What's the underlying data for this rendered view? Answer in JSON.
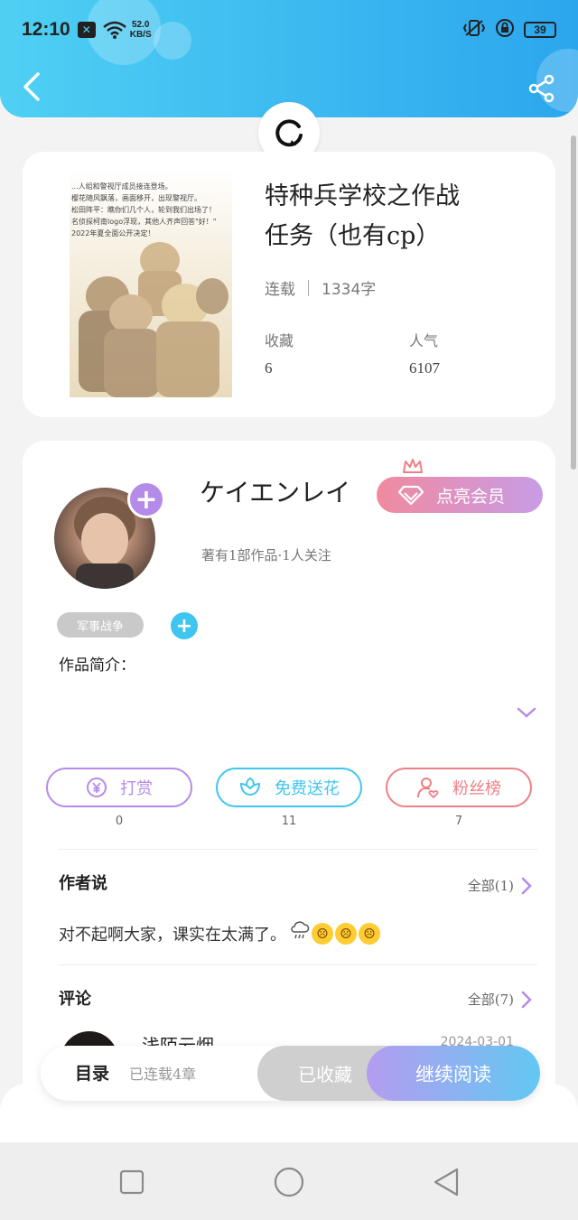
{
  "status_bar": {
    "time": "12:10",
    "net_speed_value": "52.0",
    "net_speed_unit": "KB/S",
    "battery": "39",
    "icons": [
      "x-notification-icon",
      "wifi-icon",
      "vibrate-icon",
      "lock-rotation-icon",
      "battery-icon"
    ]
  },
  "header": {
    "back_icon": "chevron-left-icon",
    "share_icon": "share-icon",
    "refresh_icon": "refresh-icon"
  },
  "book": {
    "title_line1": "特种兵学校之作战",
    "title_line2": "任务（也有cp）",
    "status": "连载",
    "word_count": "1334字",
    "favorites_label": "收藏",
    "favorites_value": "6",
    "popularity_label": "人气",
    "popularity_value": "6107",
    "cover_text": [
      "...人组和警视厅成员接连登场。",
      "樱花随风飘落，画面移开，出现警视厅。",
      "松田阵平：瞧你们几个人，轮到我们出场了！",
      "名侦探柯南logo浮现，其他人齐声回答\"好！\"",
      "2022年夏全面公开决定！"
    ]
  },
  "author": {
    "name": "ケイエンレイ",
    "meta": "著有1部作品·1人关注",
    "vip_button": "点亮会员",
    "tag": "军事战争",
    "intro_label": "作品简介："
  },
  "actions": [
    {
      "label": "打赏",
      "count": "0",
      "color": "#b48be8",
      "icon": "yen-icon"
    },
    {
      "label": "免费送花",
      "count": "11",
      "color": "#3fc6ef",
      "icon": "flower-icon"
    },
    {
      "label": "粉丝榜",
      "count": "7",
      "color": "#ee7f86",
      "icon": "fan-icon"
    }
  ],
  "author_says": {
    "title": "作者说",
    "all_label": "全部(1)",
    "content": "对不起啊大家，课实在太满了。"
  },
  "comments": {
    "title": "评论",
    "all_label": "全部(7)",
    "first_user": "浅陌云烟",
    "first_date": "2024-03-01"
  },
  "bottom_bar": {
    "toc": "目录",
    "chapters": "已连载4章",
    "favorited": "已收藏",
    "continue": "继续阅读"
  },
  "colors": {
    "header_start": "#4fd0f3",
    "header_end": "#2ba6ee",
    "accent_purple": "#b48be8",
    "accent_cyan": "#3fc6ef",
    "accent_pink": "#ee7f86"
  }
}
